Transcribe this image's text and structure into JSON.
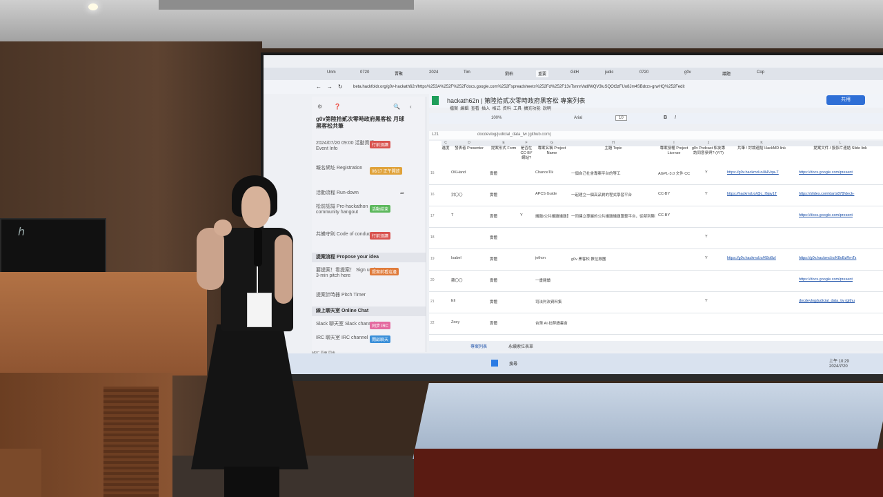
{
  "browser": {
    "tabs": [
      "Unm",
      "0720",
      "晋聚",
      "2024",
      "Tim",
      "劉柏",
      "重要",
      "GitH",
      "judic",
      "0720",
      "g0v",
      "議題",
      "Cop"
    ],
    "url": "beta.hackfoldr.org/g0v-hackath62n/https%253A%252F%252Fdocs.google.com%252Fspreadsheets%252Fd%252F13vTsnnrVat8WQV3luSQOt3zFUo8Jm4SBdrzs-grwHQ%252Fedit"
  },
  "sidebar": {
    "title": "g0v第陸拾貳次零時政府黑客松 月球黑客松共筆",
    "items": [
      {
        "label": "2024/07/20 09:00 活動資訊 Event Info",
        "badge": "行前須讀",
        "badge_color": "#d9534f"
      },
      {
        "label": "報名網址 Registration",
        "badge": "06/17 正午開放",
        "badge_color": "#e0a23a"
      },
      {
        "label": "活動流程 Run-down",
        "badge": "",
        "badge_color": ""
      },
      {
        "label": "松前認識 Pre-hackathon community hangout",
        "badge": "活動結束",
        "badge_color": "#5cb85c"
      },
      {
        "label": "共備守則 Code of conduct",
        "badge": "行前須讀",
        "badge_color": "#d9534f"
      }
    ],
    "section_propose": "提案流程 Propose your idea",
    "propose_items": [
      {
        "label": "要提案！看提案！ Sign up for a 3-min pitch here",
        "badge": "提案前看這邊",
        "badge_color": "#e07b3a"
      },
      {
        "label": "提案計時器 Pitch Timer",
        "badge": "",
        "badge_color": ""
      }
    ],
    "section_chat": "線上聊天室 Online Chat",
    "chat_items": [
      {
        "label": "Slack 聊天室 Slack channel",
        "badge": "同步 IRC",
        "badge_color": "#e46aa0"
      },
      {
        "label": "IRC 聊天室 IRC channel",
        "badge": "開啟聊天",
        "badge_color": "#3a8fd9"
      }
    ],
    "footer": "MPC 頁面 同步"
  },
  "sheet": {
    "title": "hackath62n | 第陸拾貳次零時政府黑客松 專案列表",
    "menu": [
      "檔案",
      "編輯",
      "查看",
      "插入",
      "格式",
      "資料",
      "工具",
      "擴充功能",
      "說明"
    ],
    "zoom": "100%",
    "font": "Arial",
    "font_size": "10",
    "cell_ref": "L21",
    "formula": "docdevlog/judicial_data_tw (github.com)",
    "share_label": "共用",
    "columns": [
      "C",
      "D",
      "E",
      "F",
      "G",
      "H",
      "I",
      "J",
      "K",
      "L"
    ],
    "headers": [
      "進度",
      "發表者 Presenter",
      "提案形式 Form",
      "是否在 CC-BY 網站?",
      "專案名稱 Project Name",
      "主題 Topic",
      "專案授權 Project License",
      "g0v Podcast 松友專訪同意參與? (Y/?)",
      "共筆 / 討論連結 HackMD link",
      "提案文件 / 投影片連結 Slide link"
    ],
    "rows": [
      {
        "num": "15",
        "presenter": "OKHand",
        "form": "實體",
        "cc": "",
        "name": "ChanceTik",
        "topic": "一個自己社會專案平台的等工",
        "license": "AGPL-3.0 文件 CC-BY-SA",
        "podcast": "Y",
        "hackmd": "https://g0v.hackmd.io/A4Vqa-T",
        "slide": "https://docs.google.com/present"
      },
      {
        "num": "16",
        "presenter": "洪〇〇",
        "form": "實體",
        "cc": "",
        "name": "APCS Guide",
        "topic": "一起建立一個高品質的程式學習平台",
        "license": "CC-BY",
        "podcast": "Y",
        "hackmd": "https://hackmd.io/@c_l6jav1T",
        "slide": "https://slides.com/darts878/deck-"
      },
      {
        "num": "17",
        "presenter": "T",
        "form": "實體",
        "cc": "Y",
        "name": "議題/公共議題議題匯整平台",
        "topic": "一同建立專屬的公共議題議題匯整平台，從鄰到縣到國到社會共識！",
        "license": "CC-BY",
        "podcast": "",
        "hackmd": "",
        "slide": "https://docs.google.com/present"
      },
      {
        "num": "18",
        "presenter": "",
        "form": "實體",
        "cc": "",
        "name": "",
        "topic": "",
        "license": "",
        "podcast": "Y",
        "hackmd": "",
        "slide": ""
      },
      {
        "num": "19",
        "presenter": "Isabel",
        "form": "實體",
        "cc": "",
        "name": "jothon",
        "topic": "g0v 黑客松 數位揪團",
        "license": "",
        "podcast": "Y",
        "hackmd": "https://g0v.hackmd.io/K8oBzI",
        "slide": "https://g0v.hackmd.io/K8oBzRmTs"
      },
      {
        "num": "20",
        "presenter": "蘇〇〇",
        "form": "實體",
        "cc": "",
        "name": "一畫閱讀",
        "topic": "",
        "license": "",
        "podcast": "",
        "hackmd": "",
        "slide": "https://docs.google.com/present"
      },
      {
        "num": "21",
        "presenter": "Eli",
        "form": "實體",
        "cc": "",
        "name": "司法判決資料集",
        "topic": "",
        "license": "",
        "podcast": "Y",
        "hackmd": "",
        "slide": "docdevlog/judicial_data_tw (githu"
      },
      {
        "num": "22",
        "presenter": "Zoey",
        "form": "實體",
        "cc": "",
        "name": "台灣 AI 社群讀書會",
        "topic": "",
        "license": "",
        "podcast": "",
        "hackmd": "",
        "slide": ""
      }
    ],
    "sheet_tabs": [
      "專案列表",
      "永續索位表單"
    ]
  },
  "taskbar": {
    "search": "搜尋",
    "time": "上午 10:29",
    "date": "2024/7/20"
  }
}
